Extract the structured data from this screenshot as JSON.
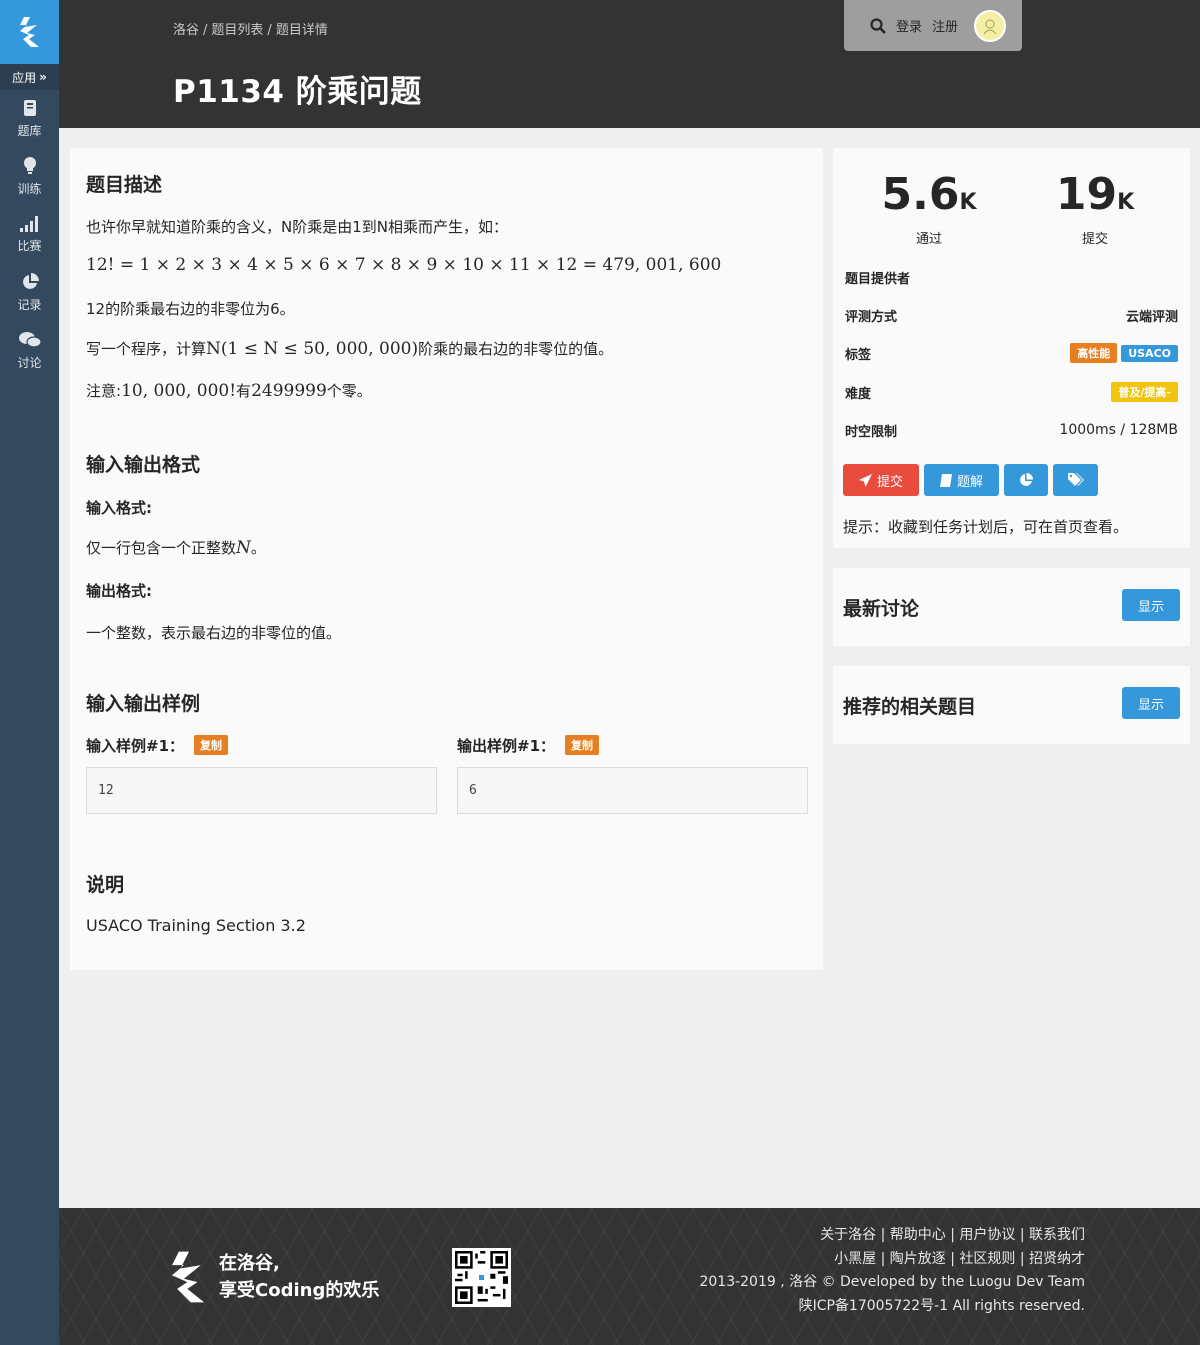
{
  "sidebar": {
    "apps_label": "应用",
    "items": [
      {
        "label": "题库",
        "icon": "book-icon"
      },
      {
        "label": "训练",
        "icon": "lightbulb-icon"
      },
      {
        "label": "比赛",
        "icon": "signal-bars-icon"
      },
      {
        "label": "记录",
        "icon": "pie-chart-icon"
      },
      {
        "label": "讨论",
        "icon": "comments-icon"
      }
    ]
  },
  "header": {
    "breadcrumb": [
      "洛谷",
      "题目列表",
      "题目详情"
    ],
    "title": "P1134 阶乘问题",
    "login": "登录",
    "register": "注册"
  },
  "problem": {
    "desc_title": "题目描述",
    "desc_p1": "也许你早就知道阶乘的含义，N阶乘是由1到N相乘而产生，如：",
    "desc_formula": "12! = 1 × 2 × 3 × 4 × 5 × 6 × 7 × 8 × 9 × 10 × 11 × 12 = 479, 001, 600",
    "desc_p3": "12的阶乘最右边的非零位为6。",
    "desc_p4_a": "写一个程序，计算",
    "desc_p4_math": "N(1 ≤ N ≤ 50, 000, 000)",
    "desc_p4_b": "阶乘的最右边的非零位的值。",
    "desc_p5_a": "注意:",
    "desc_p5_math": "10, 000, 000!",
    "desc_p5_b": "有",
    "desc_p5_num": "2499999",
    "desc_p5_c": "个零。",
    "io_title": "输入输出格式",
    "input_fmt_title": "输入格式:",
    "input_fmt_a": "仅一行包含一个正整数",
    "input_fmt_math": "N",
    "input_fmt_b": "。",
    "output_fmt_title": "输出格式:",
    "output_fmt": "一个整数，表示最右边的非零位的值。",
    "samples_title": "输入输出样例",
    "sample_in_title": "输入样例#1：",
    "sample_out_title": "输出样例#1：",
    "copy_label": "复制",
    "sample_in": "12",
    "sample_out": "6",
    "note_title": "说明",
    "note": "USACO Training Section 3.2"
  },
  "stats": {
    "passed": "5.6",
    "passed_unit": "K",
    "passed_label": "通过",
    "submitted": "19",
    "submitted_unit": "K",
    "submitted_label": "提交"
  },
  "info": {
    "provider_label": "题目提供者",
    "provider_value": "",
    "judge_label": "评测方式",
    "judge_value": "云端评测",
    "tags_label": "标签",
    "tags": [
      {
        "text": "高性能",
        "color": "#e67e22"
      },
      {
        "text": "USACO",
        "color": "#3498db"
      }
    ],
    "difficulty_label": "难度",
    "difficulty_value": "普及/提高-",
    "difficulty_color": "#f1c40f",
    "limit_label": "时空限制",
    "limit_value": "1000ms / 128MB"
  },
  "actions": {
    "submit": "提交",
    "solution": "题解",
    "submit_color": "#e74c3c",
    "blue": "#3498db"
  },
  "hint": "提示：收藏到任务计划后，可在首页查看。",
  "panels": {
    "discussions_title": "最新讨论",
    "recommend_title": "推荐的相关题目",
    "show_label": "显示"
  },
  "footer": {
    "slogan_1": "在洛谷,",
    "slogan_2": "享受Coding的欢乐",
    "links_1": "关于洛谷 | 帮助中心 | 用户协议 | 联系我们",
    "links_2": "小黑屋 | 陶片放逐 | 社区规则 | 招贤纳才",
    "copyright": "2013-2019 , 洛谷 © Developed by the Luogu Dev Team",
    "icp": "陕ICP备17005722号-1 All rights reserved."
  }
}
